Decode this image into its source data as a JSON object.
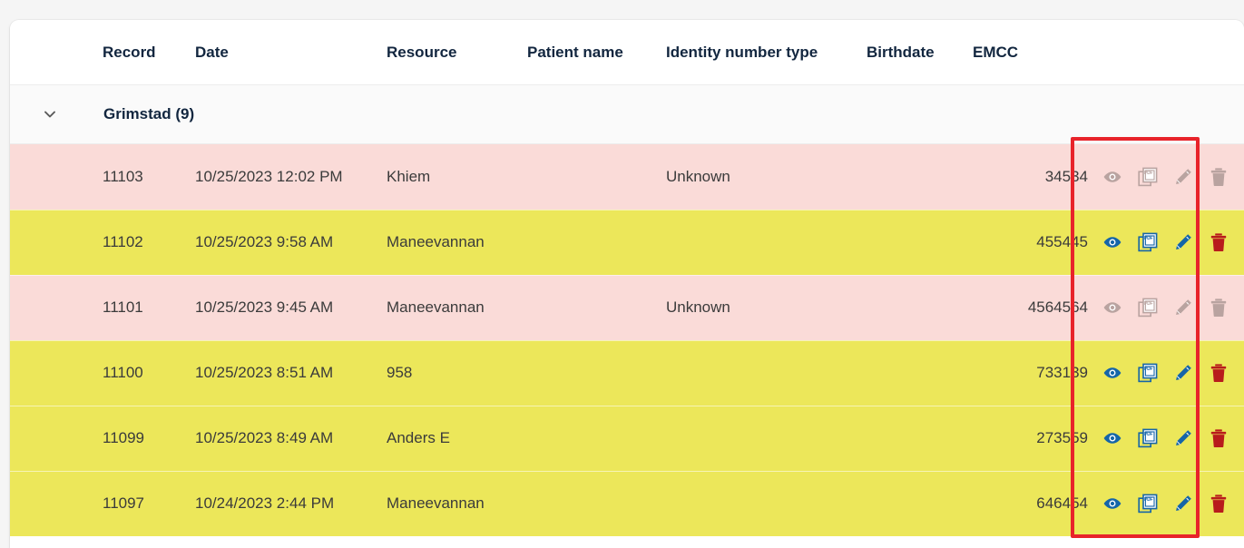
{
  "table": {
    "columns": [
      {
        "key": "record",
        "label": "Record"
      },
      {
        "key": "date",
        "label": "Date"
      },
      {
        "key": "resource",
        "label": "Resource"
      },
      {
        "key": "patient",
        "label": "Patient name"
      },
      {
        "key": "ident",
        "label": "Identity number type"
      },
      {
        "key": "birth",
        "label": "Birthdate"
      },
      {
        "key": "emcc",
        "label": "EMCC"
      }
    ],
    "group": {
      "label": "Grimstad (9)",
      "caret_icon": "chevron-down-icon",
      "expanded": true
    },
    "rows": [
      {
        "record": "11103",
        "date": "10/25/2023 12:02 PM",
        "resource": "Khiem",
        "patient": "",
        "ident": "Unknown",
        "birth": "",
        "emcc": "34534",
        "status": "pink",
        "actions_enabled": false
      },
      {
        "record": "11102",
        "date": "10/25/2023 9:58 AM",
        "resource": "Maneevannan",
        "patient": "",
        "ident": "",
        "birth": "",
        "emcc": "455445",
        "status": "yellow",
        "actions_enabled": true
      },
      {
        "record": "11101",
        "date": "10/25/2023 9:45 AM",
        "resource": "Maneevannan",
        "patient": "",
        "ident": "Unknown",
        "birth": "",
        "emcc": "4564564",
        "status": "pink",
        "actions_enabled": false
      },
      {
        "record": "11100",
        "date": "10/25/2023 8:51 AM",
        "resource": "958",
        "patient": "",
        "ident": "",
        "birth": "",
        "emcc": "733139",
        "status": "yellow",
        "actions_enabled": true
      },
      {
        "record": "11099",
        "date": "10/25/2023 8:49 AM",
        "resource": "Anders E",
        "patient": "",
        "ident": "",
        "birth": "",
        "emcc": "273559",
        "status": "yellow",
        "actions_enabled": true
      },
      {
        "record": "11097",
        "date": "10/24/2023 2:44 PM",
        "resource": "Maneevannan",
        "patient": "",
        "ident": "",
        "birth": "",
        "emcc": "646454",
        "status": "yellow",
        "actions_enabled": true
      }
    ],
    "row_actions": [
      {
        "name": "view-record-icon",
        "icon": "eye-icon",
        "label": "View"
      },
      {
        "name": "export-pdf-icon",
        "icon": "pdf-icon",
        "label": "PDF"
      },
      {
        "name": "edit-record-icon",
        "icon": "pencil-icon",
        "label": "Edit"
      },
      {
        "name": "delete-record-icon",
        "icon": "trash-icon",
        "label": "Delete"
      }
    ]
  },
  "annotation": {
    "name": "actions-column-highlight",
    "color": "#e8232a"
  },
  "colors": {
    "row_pink": "#fadbd8",
    "row_yellow": "#ece75a",
    "header_text": "#12263f",
    "cell_text": "#3b3b3b",
    "icon_active_blue": "#1565a8",
    "icon_active_red": "#b81c1c",
    "icon_disabled": "#b9a3a0",
    "card_bg": "#ffffff",
    "page_bg": "#f5f5f5",
    "group_bg": "#fafafa"
  }
}
